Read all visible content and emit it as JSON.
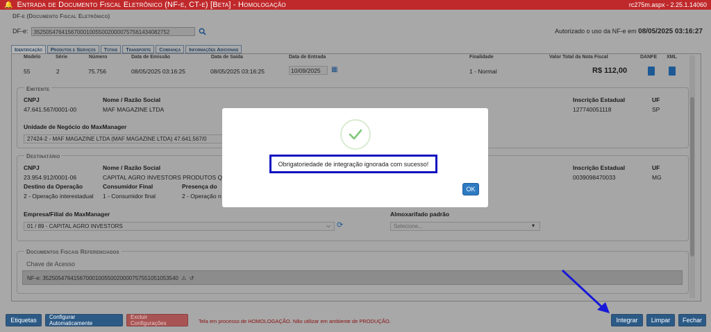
{
  "window": {
    "title": "Entrada de Documento Fiscal Eletrônico (NF-e, CT-e) [Beta]  - Homologação",
    "version": "rc275m.aspx - 2.25.1.14060"
  },
  "dfe_section": {
    "title": "DF-e (Documento Fiscal Eletrônico)",
    "label": "DF-e:",
    "key": "35250547641567000100550020000757561434082752"
  },
  "authorization": {
    "text": "Autorizado o uso da NF-e em",
    "date": "08/05/2025 03:16:27"
  },
  "tabs": [
    "Identificação",
    "Produtos e Serviços",
    "Totais",
    "Transporte",
    "Cobrança",
    "Informações Adicionais"
  ],
  "identificacao": {
    "headers": [
      "Modelo",
      "Série",
      "Número",
      "Data de Emissão",
      "Data de Saída",
      "Data de Entrada",
      "Finalidade",
      "Valor Total da Nota Fiscal",
      "DANFE",
      "XML"
    ],
    "values": {
      "modelo": "55",
      "serie": "2",
      "numero": "75.756",
      "emissao": "08/05/2025 03:16:25",
      "saida": "08/05/2025 03:16:25",
      "entrada": "10/09/2025",
      "finalidade": "1 - Normal",
      "valor": "R$ 112,00"
    }
  },
  "emitente": {
    "title": "Emitente",
    "cnpj_label": "CNPJ",
    "cnpj": "47.641.567/0001-00",
    "nome_label": "Nome / Razão Social",
    "nome": "MAF MAGAZINE LTDA",
    "ie_label": "Inscrição Estadual",
    "ie": "127740051118",
    "uf_label": "UF",
    "uf": "SP",
    "unidade_label": "Unidade de Negócio do MaxManager",
    "unidade": "27424-2 - MAF MAGAZINE LTDA (MAF MAGAZINE LTDA) 47.641.567/0"
  },
  "destinatario": {
    "title": "Destinatário",
    "cnpj_label": "CNPJ",
    "cnpj": "23.954.912/0001-06",
    "nome_label": "Nome / Razão Social",
    "nome": "CAPITAL AGRO INVESTORS PRODUTOS QU",
    "ie_label": "Inscrição Estadual",
    "ie": "0039098470033",
    "uf_label": "UF",
    "uf": "MG",
    "destino_label": "Destino da Operação",
    "destino": "2 - Operação interestadual",
    "consumidor_label": "Consumidor Final",
    "consumidor": "1 - Consumidor final",
    "presenca_label": "Presença do",
    "presenca": "2 - Operação n",
    "empresa_label": "Empresa/Filial do MaxManager",
    "empresa": "01 / 89 - CAPITAL AGRO INVESTORS",
    "almox_label": "Almoxarifado padrão",
    "almox_placeholder": "Selecione..."
  },
  "referenciados": {
    "title": "Documentos Fiscais Referenciados",
    "chave_label": "Chave de Acesso",
    "chave": "NF-e: 35250547641567000100550020000757551051053540"
  },
  "footer": {
    "etiquetas": "Etiquetas",
    "configurar": "Configurar Automaticamente",
    "excluir": "Excluir Configurações",
    "warning": "Tela em processo de HOMOLOGAÇÃO. Não utilizar em ambiente de PRODUÇÃO.",
    "integrar": "Integrar",
    "limpar": "Limpar",
    "fechar": "Fechar"
  },
  "modal": {
    "message": "Obrigatoriedade de integração ignorada com sucesso!",
    "ok": "OK"
  },
  "colors": {
    "titlebar": "#c0292b",
    "primary_button": "#2c5a86",
    "highlight_box": "#1010c0",
    "success_check": "#7fc77a",
    "annotation_arrow": "#1818d8"
  }
}
